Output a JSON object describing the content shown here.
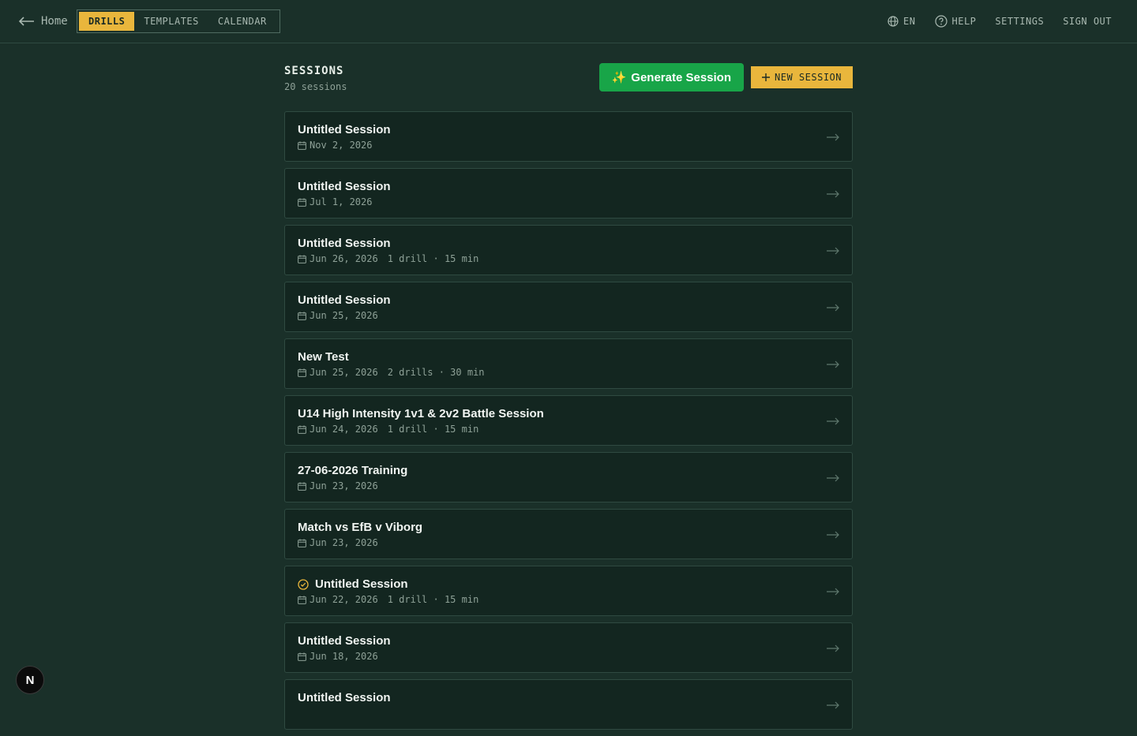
{
  "nav": {
    "home_label": "Home",
    "tabs": [
      {
        "label": "DRILLS",
        "active": true
      },
      {
        "label": "TEMPLATES",
        "active": false
      },
      {
        "label": "CALENDAR",
        "active": false
      }
    ],
    "language": "EN",
    "help": "HELP",
    "settings": "SETTINGS",
    "signout": "SIGN OUT"
  },
  "header": {
    "title": "SESSIONS",
    "count_text": "20 sessions",
    "generate_label": "Generate Session",
    "generate_icon": "✨",
    "new_label": "NEW SESSION"
  },
  "sessions": [
    {
      "title": "Untitled Session",
      "date": "Nov 2, 2026",
      "extra": "",
      "completed": false
    },
    {
      "title": "Untitled Session",
      "date": "Jul 1, 2026",
      "extra": "",
      "completed": false
    },
    {
      "title": "Untitled Session",
      "date": "Jun 26, 2026",
      "extra": "1 drill · 15 min",
      "completed": false
    },
    {
      "title": "Untitled Session",
      "date": "Jun 25, 2026",
      "extra": "",
      "completed": false
    },
    {
      "title": "New Test",
      "date": "Jun 25, 2026",
      "extra": "2 drills · 30 min",
      "completed": false
    },
    {
      "title": "U14 High Intensity 1v1 & 2v2 Battle Session",
      "date": "Jun 24, 2026",
      "extra": "1 drill · 15 min",
      "completed": false
    },
    {
      "title": "27-06-2026 Training",
      "date": "Jun 23, 2026",
      "extra": "",
      "completed": false
    },
    {
      "title": "Match vs EfB v Viborg",
      "date": "Jun 23, 2026",
      "extra": "",
      "completed": false
    },
    {
      "title": "Untitled Session",
      "date": "Jun 22, 2026",
      "extra": "1 drill · 15 min",
      "completed": true
    },
    {
      "title": "Untitled Session",
      "date": "Jun 18, 2026",
      "extra": "",
      "completed": false
    },
    {
      "title": "Untitled Session",
      "date": "",
      "extra": "",
      "completed": false
    }
  ],
  "fab_label": "N",
  "colors": {
    "background": "#1a3029",
    "card": "#132620",
    "accent_yellow": "#e9b63c",
    "accent_green": "#18a548"
  }
}
